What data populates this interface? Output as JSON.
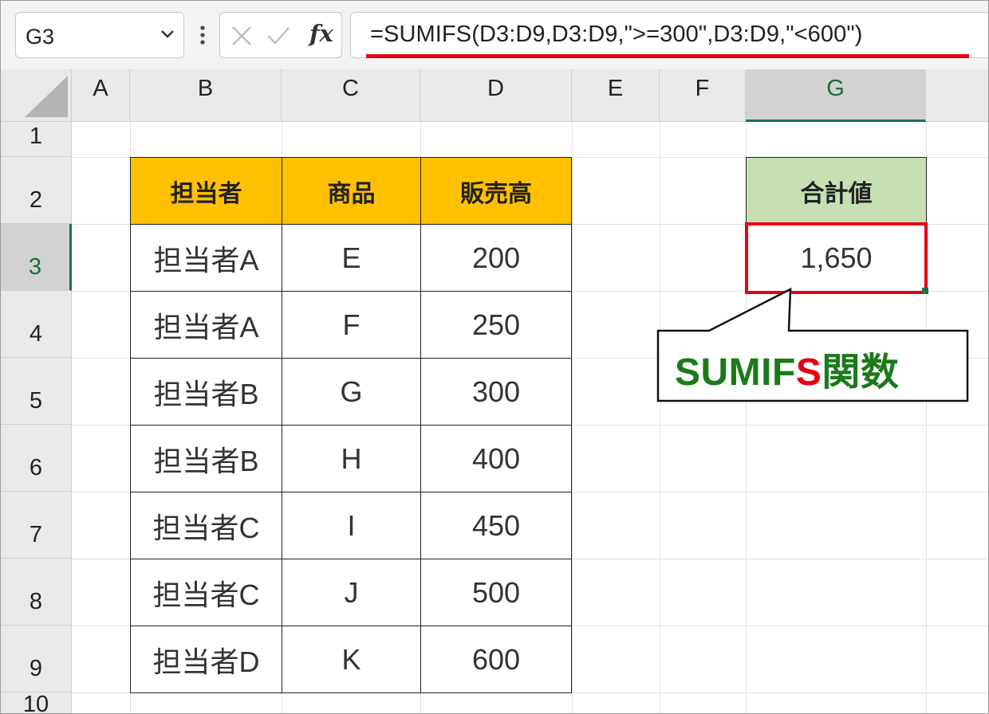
{
  "formula_bar": {
    "name_box": "G3",
    "fx_label": "fx",
    "formula": "=SUMIFS(D3:D9,D3:D9,\">=300\",D3:D9,\"<600\")"
  },
  "columns": [
    "A",
    "B",
    "C",
    "D",
    "E",
    "F",
    "G"
  ],
  "rows": [
    "1",
    "2",
    "3",
    "4",
    "5",
    "6",
    "7",
    "8",
    "9",
    "10"
  ],
  "table": {
    "headers": [
      "担当者",
      "商品",
      "販売高"
    ],
    "rows": [
      [
        "担当者A",
        "E",
        "200"
      ],
      [
        "担当者A",
        "F",
        "250"
      ],
      [
        "担当者B",
        "G",
        "300"
      ],
      [
        "担当者B",
        "H",
        "400"
      ],
      [
        "担当者C",
        "I",
        "450"
      ],
      [
        "担当者C",
        "J",
        "500"
      ],
      [
        "担当者D",
        "K",
        "600"
      ]
    ]
  },
  "result": {
    "header": "合計値",
    "value": "1,650"
  },
  "callout": {
    "part1": "SUMIF",
    "part2": "S",
    "part3": "関数"
  },
  "colors": {
    "header_fill": "#ffc000",
    "result_header_fill": "#c6e0b4",
    "highlight_red": "#e60012",
    "excel_green": "#1e7145"
  }
}
